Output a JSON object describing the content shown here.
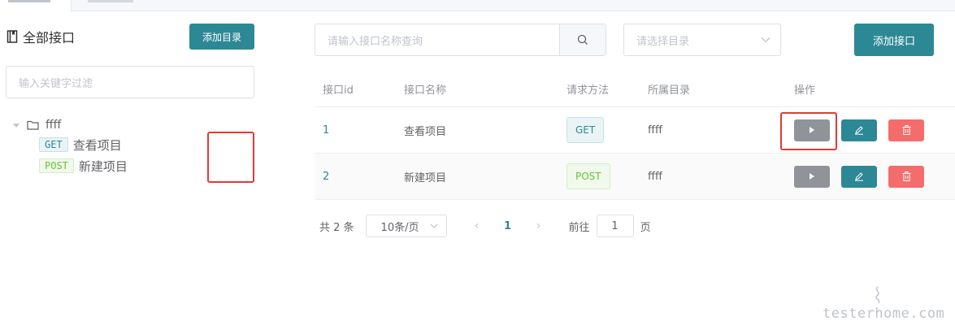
{
  "top_tabs": [],
  "left": {
    "title": "全部接口",
    "add_dir_label": "添加目录",
    "filter_placeholder": "输入关键字过滤",
    "tree": {
      "folder_name": "ffff",
      "children": [
        {
          "method": "GET",
          "name": "查看项目"
        },
        {
          "method": "POST",
          "name": "新建项目"
        }
      ]
    }
  },
  "toolbar": {
    "search_placeholder": "请输入接口名称查询",
    "select_placeholder": "请选择目录",
    "add_api_label": "添加接口"
  },
  "table": {
    "headers": [
      "接口id",
      "接口名称",
      "请求方法",
      "所属目录",
      "操作"
    ],
    "rows": [
      {
        "id": "1",
        "name": "查看项目",
        "method": "GET",
        "dir": "ffff"
      },
      {
        "id": "2",
        "name": "新建项目",
        "method": "POST",
        "dir": "ffff"
      }
    ]
  },
  "pagination": {
    "total_text": "共 2 条",
    "page_size": "10条/页",
    "current_page": "1",
    "goto_label": "前往",
    "goto_value": "1",
    "page_suffix": "页"
  },
  "watermark": "testerhome.com",
  "colors": {
    "primary": "#2d8896",
    "danger": "#f56c6c",
    "info": "#909399",
    "success": "#67c23a",
    "highlight": "#e53935"
  }
}
